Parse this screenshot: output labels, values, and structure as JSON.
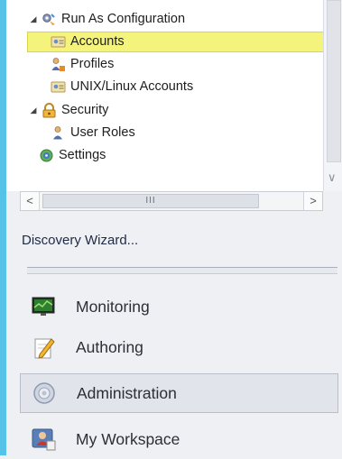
{
  "tree": {
    "items": [
      {
        "label": "Run As Configuration",
        "expander": "◢",
        "icon": "run-as-gear-icon"
      },
      {
        "label": "Accounts",
        "icon": "account-card-icon",
        "selected": true
      },
      {
        "label": "Profiles",
        "icon": "profile-person-icon"
      },
      {
        "label": "UNIX/Linux Accounts",
        "icon": "unix-account-icon"
      },
      {
        "label": "Security",
        "expander": "◢",
        "icon": "security-lock-icon"
      },
      {
        "label": "User Roles",
        "icon": "user-roles-icon"
      },
      {
        "label": "Settings",
        "icon": "settings-gear-icon"
      }
    ],
    "vscroll_arrow": "∨"
  },
  "hscroll": {
    "left_arrow": "<",
    "right_arrow": ">",
    "thumb_grip": "III"
  },
  "tasks": {
    "discovery_wizard": "Discovery Wizard..."
  },
  "nav": {
    "items": [
      {
        "label": "Monitoring",
        "icon": "monitoring-icon"
      },
      {
        "label": "Authoring",
        "icon": "authoring-pencil-icon"
      },
      {
        "label": "Administration",
        "icon": "administration-gear-icon",
        "active": true
      },
      {
        "label": "My Workspace",
        "icon": "my-workspace-icon"
      }
    ]
  },
  "colors": {
    "accent": "#55c3e8",
    "selection": "#f4f37c"
  }
}
